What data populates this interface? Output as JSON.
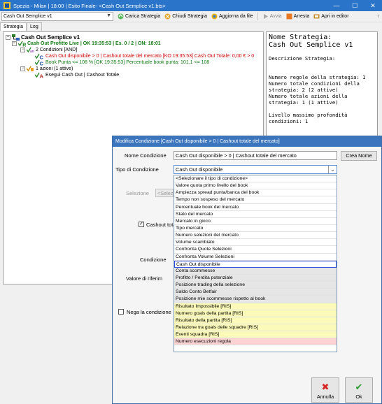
{
  "window": {
    "title": "Spezia - Milan | 18:00 | Esito Finale- <Cash Out Semplice v1.bts>",
    "minimize": "—",
    "maximize": "☐",
    "close": "✕"
  },
  "toolbar": {
    "strategy_selected": "Cash Out Semplice v1",
    "carica": "Carica Strategia",
    "chiudi": "Chiudi Strategia",
    "aggiorna": "Aggiorna da file",
    "avvia": "Avvia",
    "arresta": "Arresta",
    "apri": "Apri in editor",
    "pin": "↑"
  },
  "tabs": [
    "Strategia",
    "Log"
  ],
  "tree": {
    "root": "Cash Out Semplice v1",
    "rule": "Cash Out Profitto Live | OK 19:35:53 | Es. 0 / 2 | ON: 18:01",
    "and_group": "2 Condizioni [AND]",
    "cond1": "Cash Out disponibile > 0 | Cashout totale del mercato [KO 19:35:53] Cash Out Totale: 0,00 € > 0",
    "cond2": "Book Punta <= 108 % [OK 19:35:53] Percentuale book punta: 101,1 <= 108",
    "actions": "1 azioni (1 attive)",
    "action1": "Esegui Cash Out | Cashout Totale"
  },
  "description": {
    "heading": "Nome Strategia:",
    "name": "Cash Out Semplice v1",
    "desc_label": "Descrizione Strategia:",
    "lines": [
      "Numero regole della strategia: 1",
      "Numero totale condizioni della",
      "strategia: 2 (2 attive)",
      "Numero totale azioni della",
      "strategia: 1 (1 attive)",
      "",
      "Livello massimo profondità",
      "condizioni: 1"
    ]
  },
  "dialog": {
    "title": "Modifica Condizione [Cash Out disponibile > 0 | Cashout totale del mercato]",
    "nome_label": "Nome Condizione",
    "nome_value": "Cash Out disponibile > 0 | Cashout totale del mercato",
    "crea_nome": "Crea Nome",
    "tipo_label": "Tipo di Condizione",
    "tipo_value": "Cash Out disponibile",
    "selezione_label": "Selezione",
    "selezione_partial": "<Selezio",
    "cashout_partial": "Cashout tota",
    "condizione_label": "Condizione",
    "riferimento_partial": "Valore di riferim",
    "nega_label": "Nega la condizione",
    "annulla": "Annulla",
    "ok": "Ok",
    "options": [
      {
        "label": "<Selezionare il tipo di condizione>",
        "style": "white"
      },
      {
        "label": "Valore quota primo livello del book",
        "style": "white"
      },
      {
        "label": "Ampiezza spread punta/banca del book",
        "style": "white"
      },
      {
        "label": "Tempo non sospeso del mercato",
        "style": "white"
      },
      {
        "label": "Percentuale book del mercato",
        "style": "white"
      },
      {
        "label": "Stato del mercato",
        "style": "white"
      },
      {
        "label": "Mercato in gioco",
        "style": "white"
      },
      {
        "label": "Tipo mercato",
        "style": "white"
      },
      {
        "label": "Numero selezioni del mercato",
        "style": "white"
      },
      {
        "label": "Volume scambiato",
        "style": "white"
      },
      {
        "label": "Confronta Quote Selezioni",
        "style": "white"
      },
      {
        "label": "Confronta Volume Selezioni",
        "style": "white"
      },
      {
        "label": "Cash Out disponibile",
        "style": "sel"
      },
      {
        "label": "Conta scommesse",
        "style": "gray"
      },
      {
        "label": "Profitto / Perdita potenziale",
        "style": "gray"
      },
      {
        "label": "Posizione trading della selezione",
        "style": "gray"
      },
      {
        "label": "Saldo Conto Betfair",
        "style": "gray"
      },
      {
        "label": "Posizione mie scommesse rispetto al book",
        "style": "gray"
      },
      {
        "label": "Risultato Impossibile [RIS]",
        "style": "yellow"
      },
      {
        "label": "Numero goals della partita [RIS]",
        "style": "yellow"
      },
      {
        "label": "Risultato della partita [RIS]",
        "style": "yellow"
      },
      {
        "label": "Relazione tra goals delle squadre [RIS]",
        "style": "yellow"
      },
      {
        "label": "Eventi squadra [RIS]",
        "style": "yellow"
      },
      {
        "label": "Numero esecuzioni regola",
        "style": "pink"
      }
    ]
  }
}
